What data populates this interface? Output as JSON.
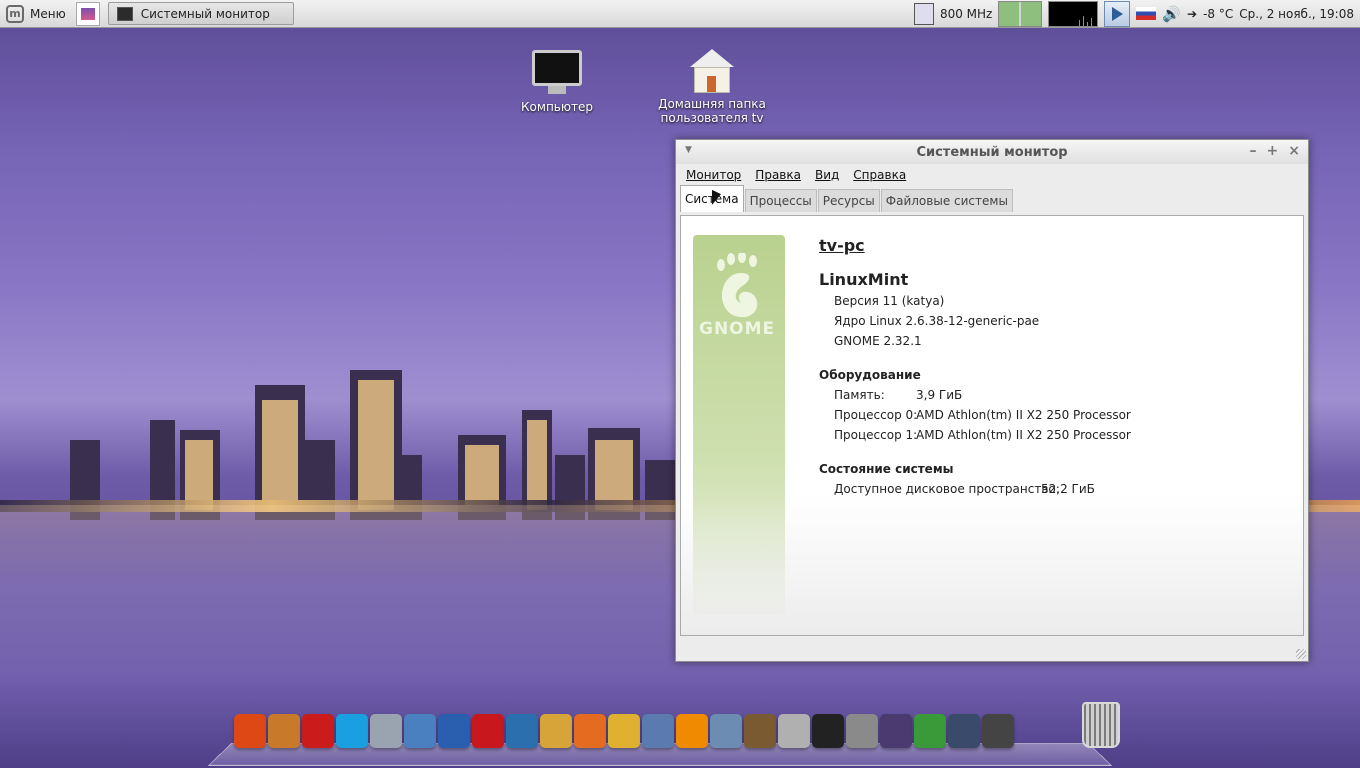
{
  "top_panel": {
    "menu_label": "Меню",
    "task_label": "Системный монитор",
    "cpu_freq": "800 MHz",
    "temperature": "-8 °C",
    "datetime": "Ср., 2 нояб., 19:08"
  },
  "desktop": {
    "computer_label": "Компьютер",
    "home_label_line1": "Домашняя папка",
    "home_label_line2": "пользователя tv"
  },
  "window": {
    "title": "Системный монитор",
    "menu": [
      "Монитор",
      "Правка",
      "Вид",
      "Справка"
    ],
    "tabs": [
      "Система",
      "Процессы",
      "Ресурсы",
      "Файловые системы"
    ],
    "active_tab": "Система",
    "logo_text": "GNOME",
    "hostname": "tv-pc",
    "distro": "LinuxMint",
    "version": "Версия 11 (katya)",
    "kernel": "Ядро Linux 2.6.38-12-generic-pae",
    "gnome": "GNOME 2.32.1",
    "hardware_heading": "Оборудование",
    "memory_label": "Память:",
    "memory_value": "3,9 ГиБ",
    "cpu0_label": "Процессор 0:",
    "cpu0_value": "AMD Athlon(tm) II X2 250 Processor",
    "cpu1_label": "Процессор 1:",
    "cpu1_value": "AMD Athlon(tm) II X2 250 Processor",
    "status_heading": "Состояние системы",
    "disk_label": "Доступное дисковое пространство:",
    "disk_value": "52,2 ГиБ"
  },
  "dock": {
    "items": [
      {
        "icon": "ubuntu-icon",
        "color": "#dd4814"
      },
      {
        "icon": "eye-icon",
        "color": "#c87a2a"
      },
      {
        "icon": "opera-icon",
        "color": "#cc1b1b"
      },
      {
        "icon": "skype-icon",
        "color": "#1a9fe0"
      },
      {
        "icon": "drop-icon",
        "color": "#9aa4b0"
      },
      {
        "icon": "mail-icon",
        "color": "#4a7fc0"
      },
      {
        "icon": "globe-icon",
        "color": "#2a5fb0"
      },
      {
        "icon": "filezilla-icon",
        "color": "#c8181e"
      },
      {
        "icon": "network-icon",
        "color": "#2b6fae"
      },
      {
        "icon": "paint-icon",
        "color": "#d7a43a"
      },
      {
        "icon": "firefox-icon",
        "color": "#e46b20"
      },
      {
        "icon": "cd-icon",
        "color": "#e0b030"
      },
      {
        "icon": "monitor-icon",
        "color": "#5a7ab0"
      },
      {
        "icon": "vlc-icon",
        "color": "#f08a00"
      },
      {
        "icon": "play-icon",
        "color": "#6c8cb4"
      },
      {
        "icon": "speaker-icon",
        "color": "#7a5a30"
      },
      {
        "icon": "volume-icon",
        "color": "#b0b0b0"
      },
      {
        "icon": "terminal-icon",
        "color": "#222222"
      },
      {
        "icon": "calculator-icon",
        "color": "#8a8a8a"
      },
      {
        "icon": "compass-icon",
        "color": "#4a3a70"
      },
      {
        "icon": "recycle-icon",
        "color": "#3a9a3a"
      },
      {
        "icon": "screenshot-icon",
        "color": "#3a4a6a"
      },
      {
        "icon": "power-icon",
        "color": "#444444"
      }
    ]
  }
}
